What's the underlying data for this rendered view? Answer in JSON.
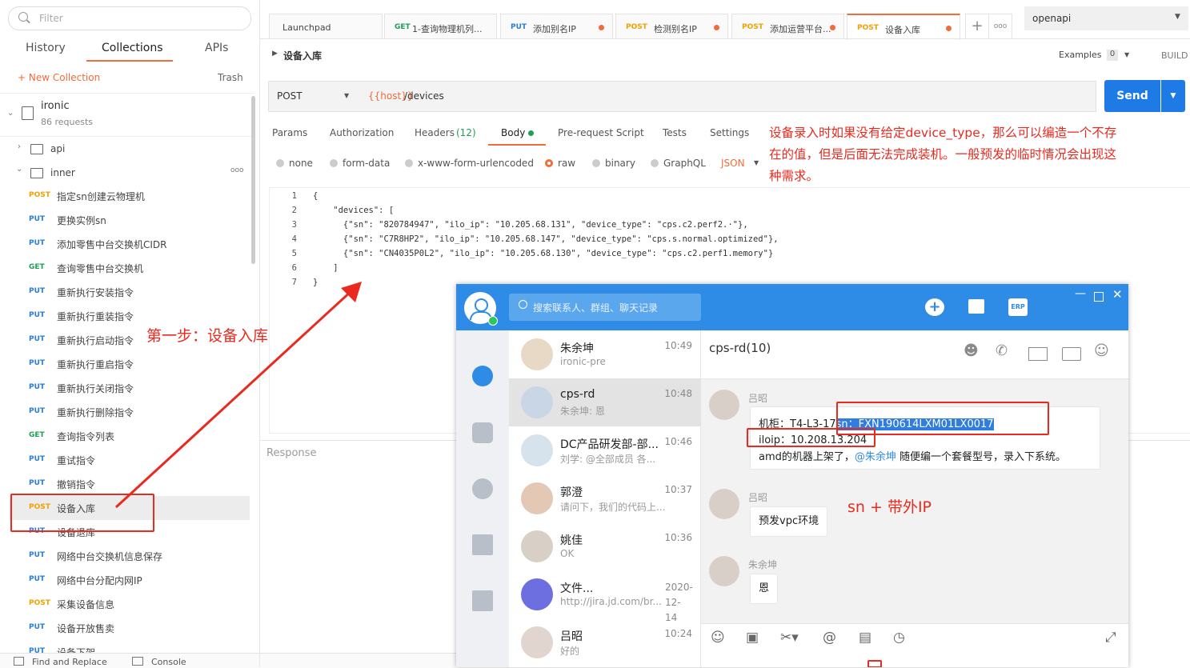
{
  "sidebar": {
    "filter_placeholder": "Filter",
    "tabs": [
      "History",
      "Collections",
      "APIs"
    ],
    "new_collection": "+ New Collection",
    "trash": "Trash",
    "collection": {
      "name": "ironic",
      "count": "86 requests"
    },
    "folders": [
      {
        "name": "api"
      },
      {
        "name": "inner"
      }
    ],
    "more": "ooo",
    "requests": [
      {
        "method": "POST",
        "name": "指定sn创建云物理机"
      },
      {
        "method": "PUT",
        "name": "更换实例sn"
      },
      {
        "method": "PUT",
        "name": "添加零售中台交换机CIDR"
      },
      {
        "method": "GET",
        "name": "查询零售中台交换机"
      },
      {
        "method": "PUT",
        "name": "重新执行安装指令"
      },
      {
        "method": "PUT",
        "name": "重新执行重装指令"
      },
      {
        "method": "PUT",
        "name": "重新执行启动指令"
      },
      {
        "method": "PUT",
        "name": "重新执行重启指令"
      },
      {
        "method": "PUT",
        "name": "重新执行关闭指令"
      },
      {
        "method": "PUT",
        "name": "重新执行删除指令"
      },
      {
        "method": "GET",
        "name": "查询指令列表"
      },
      {
        "method": "PUT",
        "name": "重试指令"
      },
      {
        "method": "PUT",
        "name": "撤销指令"
      },
      {
        "method": "POST",
        "name": "设备入库"
      },
      {
        "method": "PUT",
        "name": "设备退库"
      },
      {
        "method": "PUT",
        "name": "网络中台交换机信息保存"
      },
      {
        "method": "PUT",
        "name": "网络中台分配内网IP"
      },
      {
        "method": "POST",
        "name": "采集设备信息"
      },
      {
        "method": "PUT",
        "name": "设备开放售卖"
      },
      {
        "method": "PUT",
        "name": "设备下架"
      }
    ],
    "footer": {
      "find": "Find and Replace",
      "console": "Console"
    }
  },
  "tabs": [
    {
      "method": "",
      "title": "Launchpad",
      "dot": false
    },
    {
      "method": "GET",
      "title": "1-查询物理机列...",
      "dot": false
    },
    {
      "method": "PUT",
      "title": "添加别名IP",
      "dot": true
    },
    {
      "method": "POST",
      "title": "检测别名IP",
      "dot": true
    },
    {
      "method": "POST",
      "title": "添加运营平台...",
      "dot": true
    },
    {
      "method": "POST",
      "title": "设备入库",
      "dot": true
    }
  ],
  "tab_more": "ooo",
  "environment": "openapi",
  "request": {
    "breadcrumb": "设备入库",
    "examples_label": "Examples",
    "examples_count": "0",
    "build": "BUILD",
    "method": "POST",
    "url_var": "{{host}}",
    "url_path": "/devices",
    "send": "Send"
  },
  "subtabs": [
    "Params",
    "Authorization",
    "Headers",
    "(12)",
    "Body",
    "Pre-request Script",
    "Tests",
    "Settings"
  ],
  "body_types": [
    "none",
    "form-data",
    "x-www-form-urlencoded",
    "raw",
    "binary",
    "GraphQL"
  ],
  "body_format": "JSON",
  "code_lines": [
    {
      "n": "1",
      "text": "{"
    },
    {
      "n": "2",
      "text": "    \"devices\": ["
    },
    {
      "n": "3",
      "text": "      {\"sn\": \"820784947\", \"ilo_ip\": \"10.205.68.131\", \"device_type\": \"cps.c2.perf2.·\"},"
    },
    {
      "n": "4",
      "text": "      {\"sn\": \"C7R8HP2\", \"ilo_ip\": \"10.205.68.147\", \"device_type\": \"cps.s.normal.optimized\"},"
    },
    {
      "n": "5",
      "text": "      {\"sn\": \"CN4035P0L2\", \"ilo_ip\": \"10.205.68.130\", \"device_type\": \"cps.c2.perf1.memory\"}"
    },
    {
      "n": "6",
      "text": "    ]"
    },
    {
      "n": "7",
      "text": "}"
    }
  ],
  "response_label": "Response",
  "annotations": {
    "step1": "第一步：设备入库",
    "note_lines": [
      "设备录入时如果没有给定device_type，那么可以编造一个不存",
      "在的值，但是后面无法完成装机。一般预发的临时情况会出现这",
      "种需求。"
    ],
    "sn_ip": "sn + 带外IP"
  },
  "chat": {
    "search_placeholder": "搜索联系人、群组、聊天记录",
    "erp": "ERP",
    "title": "cps-rd(10)",
    "conversations": [
      {
        "name": "朱余坤",
        "preview": "ironic-pre",
        "time": "10:49"
      },
      {
        "name": "cps-rd",
        "preview": "朱余坤: 恩",
        "time": "10:48"
      },
      {
        "name": "DC产品研发部-部...",
        "preview": "刘学: @全部成员  各...",
        "time": "10:46"
      },
      {
        "name": "郭澄",
        "preview": "请问下，我们的代码上...",
        "time": "10:37"
      },
      {
        "name": "姚佳",
        "preview": "OK",
        "time": "10:36"
      },
      {
        "name": "文件...",
        "preview": "http://jira.jd.com/br...",
        "time": "2020-12-14"
      },
      {
        "name": "吕昭",
        "preview": "好的",
        "time": "10:24"
      }
    ],
    "messages": [
      {
        "sender": "吕昭",
        "lines": [
          "机柜：T4-L3-17",
          "sn：FXN190614LXM01LX0017",
          "iloip：10.208.13.204",
          "amd的机器上架了，",
          "@朱余坤",
          " 随便编一个套餐型号，录入下系统。"
        ]
      },
      {
        "sender": "吕昭",
        "lines": [
          "预发vpc环境"
        ]
      },
      {
        "sender": "朱余坤",
        "lines": [
          "恩"
        ]
      }
    ]
  }
}
